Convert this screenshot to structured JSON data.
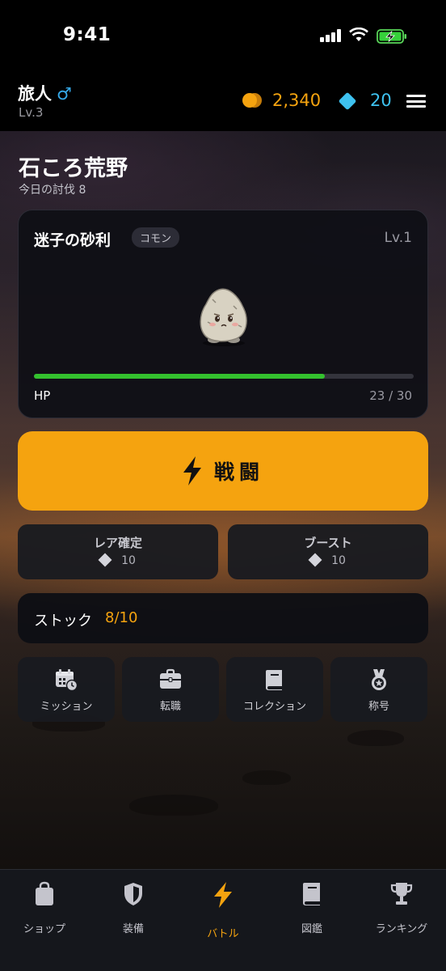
{
  "status_bar": {
    "time": "9:41"
  },
  "header": {
    "player_name": "旅人",
    "gender_symbol": "♂",
    "player_level": "Lv.3",
    "coins": "2,340",
    "gems": "20",
    "colors": {
      "coin": "#f5a30f",
      "gem": "#3ec2f0"
    }
  },
  "area": {
    "name": "石ころ荒野",
    "kills_text": "今日の討伐 8"
  },
  "monster": {
    "name": "迷子の砂利",
    "rarity": "コモン",
    "level": "Lv.1",
    "hp_label": "HP",
    "hp_current": 23,
    "hp_max": 30,
    "hp_text": "23 / 30",
    "hp_color": "#34c12e"
  },
  "battle_button": {
    "label": "戦闘",
    "icon": "lightning-icon",
    "color": "#f5a30f"
  },
  "actions": [
    {
      "label": "レア確定",
      "cost": "10",
      "icon": "diamond-icon"
    },
    {
      "label": "ブースト",
      "cost": "10",
      "icon": "diamond-icon"
    }
  ],
  "stock": {
    "label": "ストック",
    "value": "8/10"
  },
  "menu_grid": [
    {
      "label": "ミッション",
      "icon": "calendar-clock-icon"
    },
    {
      "label": "転職",
      "icon": "briefcase-icon"
    },
    {
      "label": "コレクション",
      "icon": "book-icon"
    },
    {
      "label": "称号",
      "icon": "medal-icon"
    }
  ],
  "tabs": [
    {
      "label": "ショップ",
      "icon": "bag-icon",
      "active": false
    },
    {
      "label": "装備",
      "icon": "shield-icon",
      "active": false
    },
    {
      "label": "バトル",
      "icon": "lightning-icon",
      "active": true
    },
    {
      "label": "図鑑",
      "icon": "book-icon",
      "active": false
    },
    {
      "label": "ランキング",
      "icon": "trophy-icon",
      "active": false
    }
  ]
}
